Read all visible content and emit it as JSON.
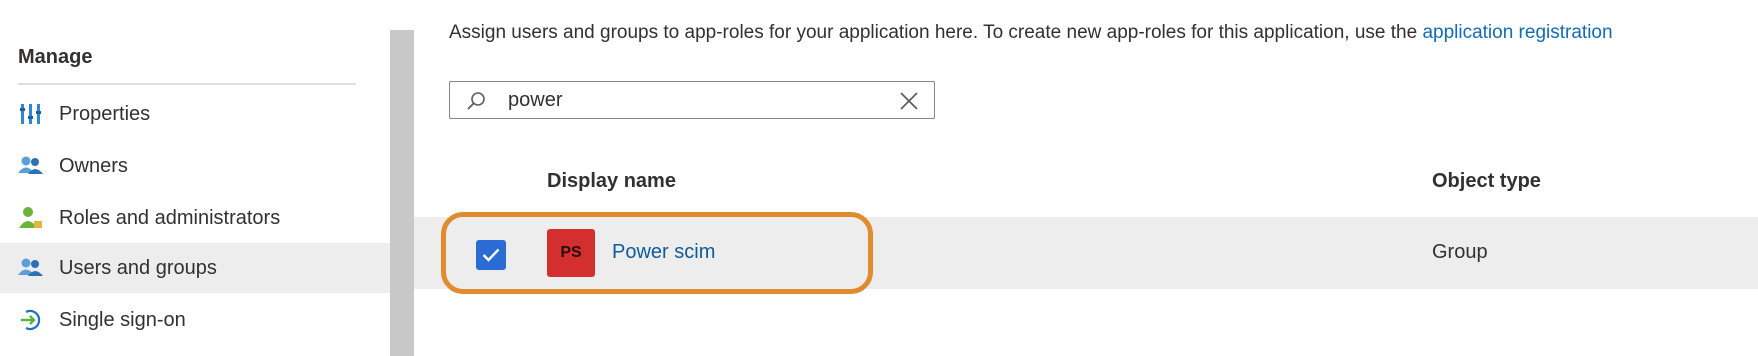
{
  "sidebar": {
    "section_title": "Manage",
    "items": [
      {
        "label": "Properties",
        "icon": "properties-icon",
        "selected": false
      },
      {
        "label": "Owners",
        "icon": "owners-icon",
        "selected": false
      },
      {
        "label": "Roles and administrators",
        "icon": "roles-icon",
        "selected": false
      },
      {
        "label": "Users and groups",
        "icon": "users-groups-icon",
        "selected": true
      },
      {
        "label": "Single sign-on",
        "icon": "single-sign-on-icon",
        "selected": false
      }
    ]
  },
  "main": {
    "description": "Assign users and groups to app-roles for your application here. To create new app-roles for this application, use the",
    "description_link": "application registration",
    "search": {
      "value": "power"
    },
    "columns": {
      "display_name": "Display name",
      "object_type": "Object type"
    },
    "rows": [
      {
        "initials": "PS",
        "name": "Power scim",
        "type": "Group",
        "checked": true
      }
    ]
  },
  "colors": {
    "accent": "#0f6cbd",
    "checkbox": "#2b6cd4",
    "avatar": "#d42f2f",
    "highlight": "#e08c2e",
    "selected_row": "#ededed"
  }
}
